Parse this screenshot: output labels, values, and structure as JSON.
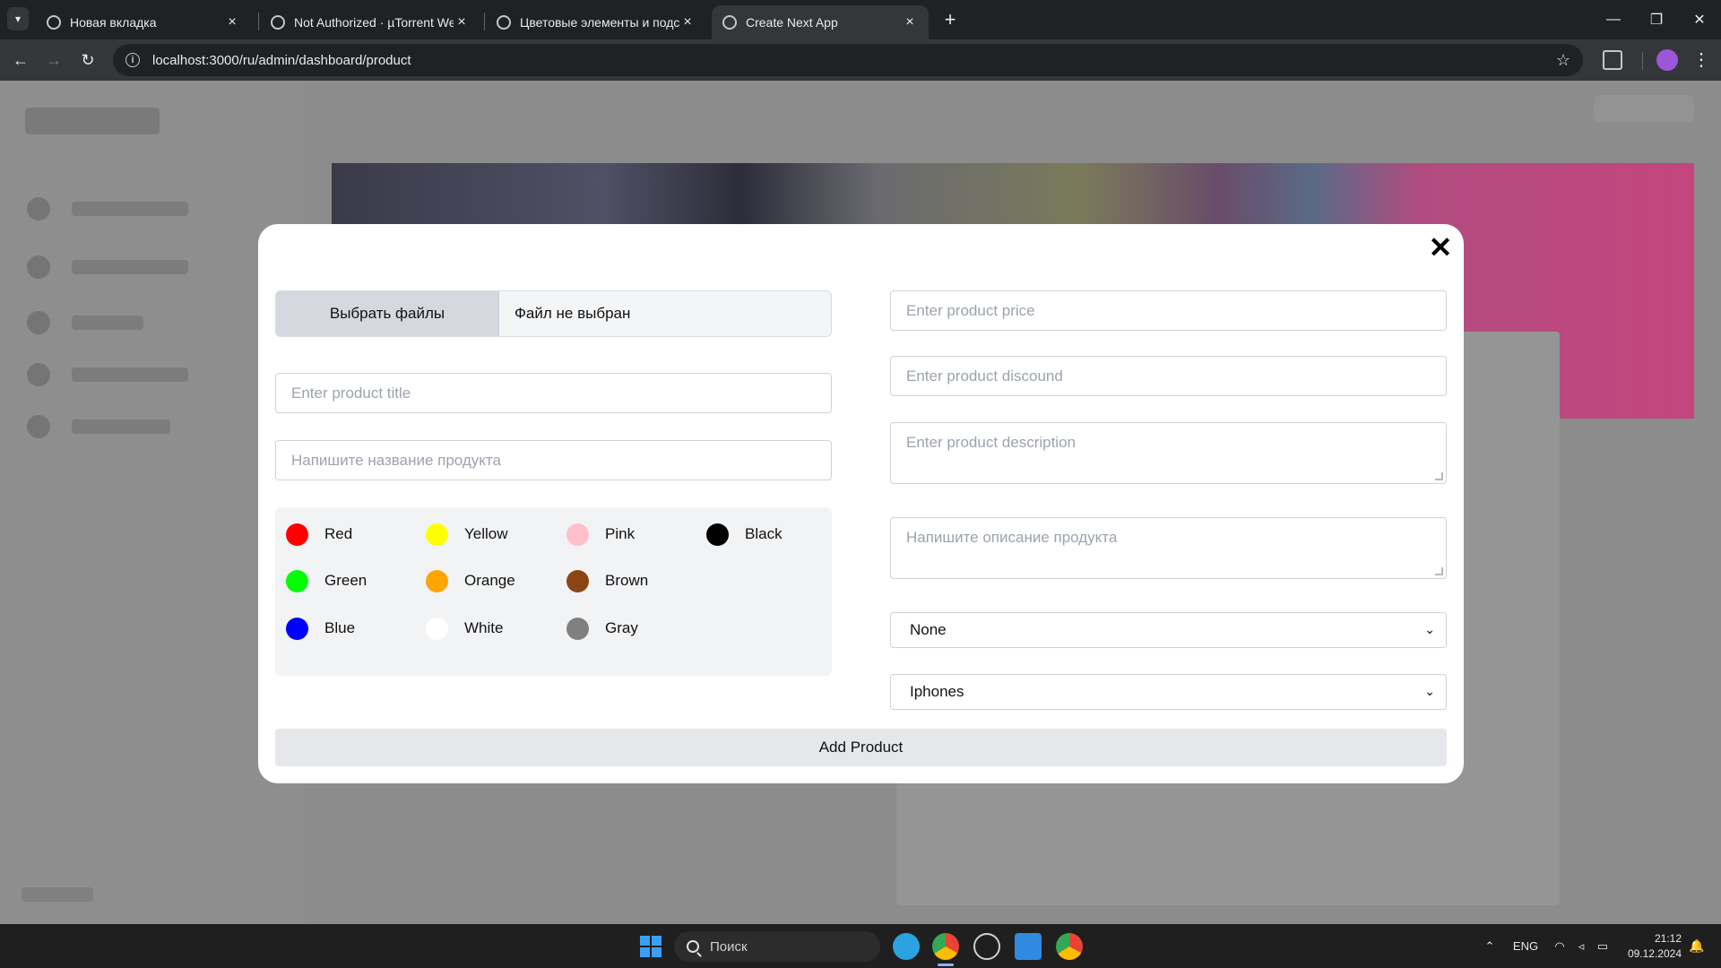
{
  "browser": {
    "tabs": [
      {
        "label": "Новая вкладка",
        "active": false
      },
      {
        "label": "Not Authorized · µTorrent Web",
        "active": false
      },
      {
        "label": "Цветовые элементы и подсве",
        "active": false
      },
      {
        "label": "Create Next App",
        "active": true
      }
    ],
    "url": "localhost:3000/ru/admin/dashboard/product"
  },
  "modal": {
    "file": {
      "button_label": "Выбрать файлы",
      "status": "Файл не выбран"
    },
    "title_placeholder": "Enter product title",
    "title_ru_placeholder": "Напишите название продукта",
    "colors": [
      {
        "label": "Red",
        "color": "#ff0000"
      },
      {
        "label": "Yellow",
        "color": "#ffff00"
      },
      {
        "label": "Pink",
        "color": "#ffc0cb"
      },
      {
        "label": "Black",
        "color": "#000000"
      },
      {
        "label": "Green",
        "color": "#00ff00"
      },
      {
        "label": "Orange",
        "color": "#ffa500"
      },
      {
        "label": "Brown",
        "color": "#8b4513"
      },
      {
        "label": "Blue",
        "color": "#0000ff"
      },
      {
        "label": "White",
        "color": "#ffffff"
      },
      {
        "label": "Gray",
        "color": "#808080"
      }
    ],
    "price_placeholder": "Enter product price",
    "discount_placeholder": "Enter product discound",
    "description_placeholder": "Enter product description",
    "description_ru_placeholder": "Напишите описание продукта",
    "select_1": "None",
    "select_2": "Iphones",
    "submit_label": "Add Product"
  },
  "taskbar": {
    "search_label": "Поиск",
    "lang": "ENG",
    "time": "21:12",
    "date": "09.12.2024"
  }
}
